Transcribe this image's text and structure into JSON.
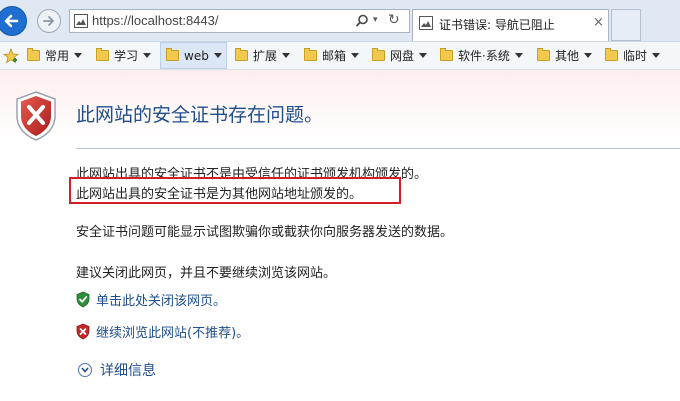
{
  "browser": {
    "address_url": "https://localhost:8443/",
    "tab_title": "证书错误: 导航已阻止",
    "tab_close": "×",
    "refresh_glyph": "↻",
    "dropdown_glyph": "▾"
  },
  "favorites": [
    {
      "label": "常用"
    },
    {
      "label": "学习"
    },
    {
      "label": "web"
    },
    {
      "label": "扩展"
    },
    {
      "label": "邮箱"
    },
    {
      "label": "网盘"
    },
    {
      "label": "软件·系统"
    },
    {
      "label": "其他"
    },
    {
      "label": "临时"
    }
  ],
  "page": {
    "title": "此网站的安全证书存在问题。",
    "line1": "此网站出具的安全证书不是由受信任的证书颁发机构颁发的。",
    "line2": "此网站出具的安全证书是为其他网站地址颁发的。",
    "line3": "安全证书问题可能显示试图欺骗你或截获你向服务器发送的数据。",
    "line4": "建议关闭此网页，并且不要继续浏览该网站。",
    "close_link": "单击此处关闭该网页。",
    "continue_link": "继续浏览此网站(不推荐)。",
    "details_link": "详细信息"
  },
  "colors": {
    "link": "#1f4e8c",
    "highlight": "#d21f26",
    "shield_red": "#c62828",
    "shield_green": "#2e8b3a"
  }
}
